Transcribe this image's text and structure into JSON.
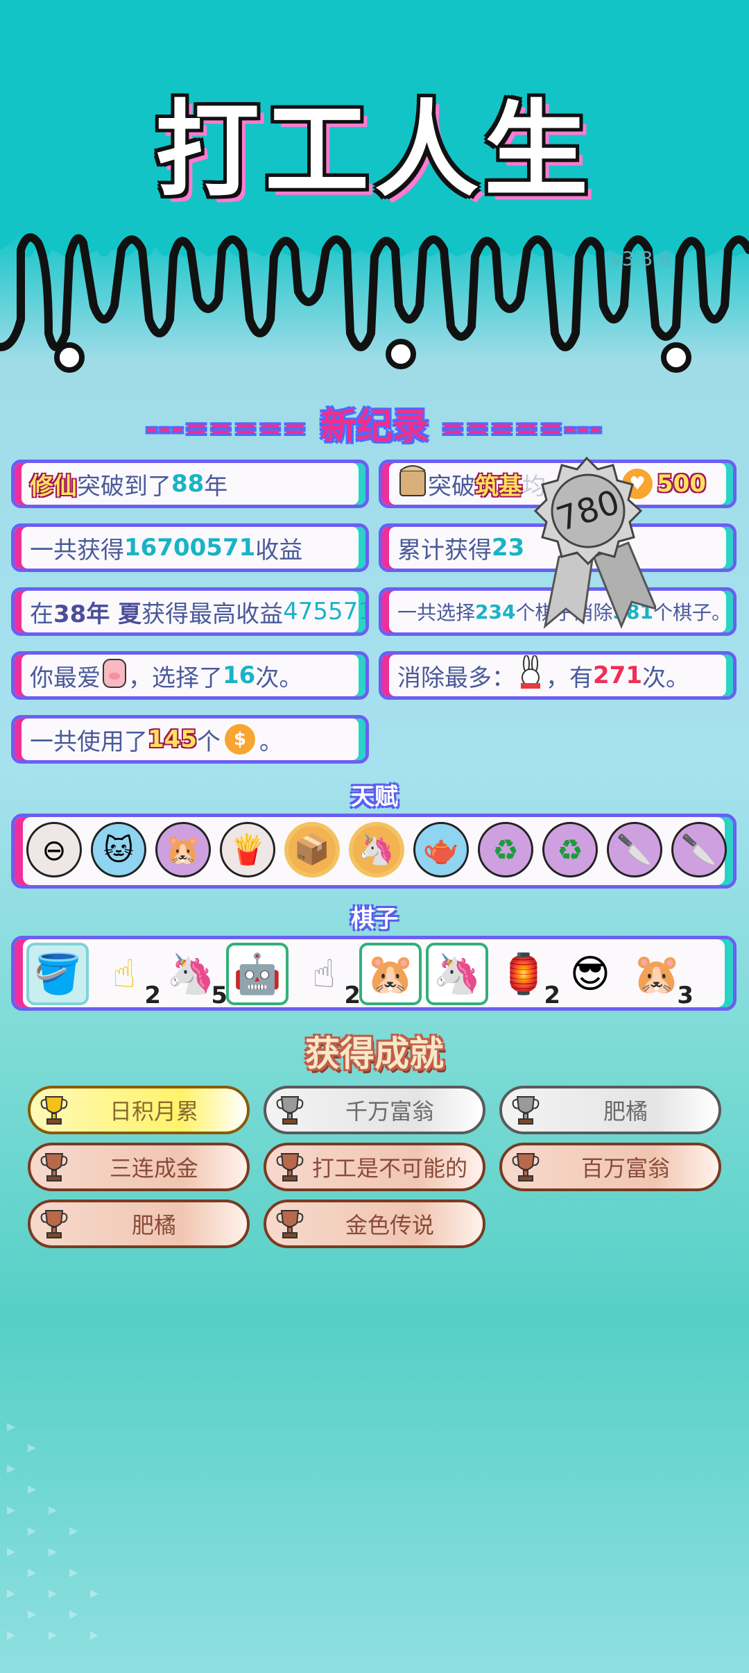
{
  "app": {
    "title": "打工人生",
    "version": "v3.8.6"
  },
  "new_record": {
    "title": "新纪录",
    "left_deco": "---=====",
    "right_deco": "=====---",
    "badge_value": "780",
    "cards": [
      {
        "a": "修仙",
        "b": "突破到了",
        "c": "88",
        "d": "年"
      },
      {
        "a": "突破",
        "b": "筑基",
        "c": "均",
        "d": "除",
        "e": "500"
      },
      {
        "a": "一共获得",
        "b": "16700571",
        "c": "收益"
      },
      {
        "a": "累计获得",
        "b": "23"
      },
      {
        "a": "在 ",
        "b": "38年 夏",
        "c": " 获得最高收益",
        "d": "4755719"
      },
      {
        "a": "一共选择",
        "b": "234",
        "c": "个棋子",
        "d": "消除",
        "e": "581",
        "f": "个棋子。"
      },
      {
        "a": "你最爱",
        "b": "，选择了",
        "c": "16",
        "d": "次。"
      },
      {
        "a": "消除最多：",
        "b": "，有",
        "c": "271",
        "d": "次。"
      },
      {
        "a": "一共使用了",
        "b": "145",
        "c": "个",
        "d": "。"
      }
    ]
  },
  "talents": {
    "title": "天赋",
    "items": [
      "minus-coin-icon",
      "snow-cat-icon",
      "hamsters-icon",
      "fries-icon",
      "tissue-box-icon",
      "unicorn-icon",
      "gravy-boat-icon",
      "recycle-icon",
      "recycle-icon",
      "cleaver-icon",
      "cleaver-icon"
    ]
  },
  "pieces": {
    "title": "棋子",
    "items": [
      {
        "icon": "bucket-icon",
        "count": ""
      },
      {
        "icon": "yellow-hand-icon",
        "count": "2"
      },
      {
        "icon": "unicorn-icon",
        "count": "5"
      },
      {
        "icon": "robot-worker-icon",
        "count": ""
      },
      {
        "icon": "gray-hand-icon",
        "count": "2"
      },
      {
        "icon": "hamster-icon",
        "count": ""
      },
      {
        "icon": "unicorn-icon",
        "count": ""
      },
      {
        "icon": "lantern-house-icon",
        "count": "2"
      },
      {
        "icon": "green-hair-guy-icon",
        "count": ""
      },
      {
        "icon": "hamster-icon",
        "count": "3"
      }
    ]
  },
  "achievements": {
    "title": "获得成就",
    "items": [
      {
        "label": "日积月累",
        "tier": "gold"
      },
      {
        "label": "千万富翁",
        "tier": "silver"
      },
      {
        "label": "肥橘",
        "tier": "silver"
      },
      {
        "label": "三连成金",
        "tier": "bronze"
      },
      {
        "label": "打工是不可能的",
        "tier": "bronze"
      },
      {
        "label": "百万富翁",
        "tier": "bronze"
      },
      {
        "label": "肥橘",
        "tier": "bronze"
      },
      {
        "label": "金色传说",
        "tier": "bronze"
      }
    ]
  },
  "colors": {
    "accent_pink": "#f02e9a",
    "accent_teal": "#2bd3c7",
    "frame_purple": "#6b5ff2"
  }
}
